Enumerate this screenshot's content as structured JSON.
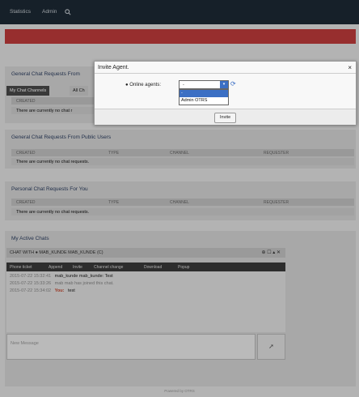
{
  "nav": {
    "items": [
      "Statistics",
      "Admin"
    ],
    "search_icon": "search-icon"
  },
  "sections": {
    "general_from": "General Chat Requests From",
    "general_public": "General Chat Requests From Public Users",
    "personal": "Personal Chat Requests For You",
    "active": "My Active Chats"
  },
  "tabs": {
    "my_channels": "My Chat Channels",
    "all": "All Ch"
  },
  "table": {
    "created": "CREATED",
    "type": "TYPE",
    "channel": "CHANNEL",
    "requester": "REQUESTER",
    "empty_partial": "There are currently no chat r",
    "empty": "There are currently no chat requests."
  },
  "modal": {
    "title": "Invite Agent.",
    "close": "×",
    "label": "Online agents:",
    "bullet": "●",
    "selected": "-",
    "options": [
      "-",
      "Admin OTRS"
    ],
    "invite": "Invite"
  },
  "chat": {
    "header": "CHAT WITH ● MAB_KUNDE MAB_KUNDE (C)",
    "header_controls": "⊕ ☐ ▴ ✕",
    "tools": [
      "Phone ticket",
      "Append",
      "Invite",
      "Channel change",
      "Download",
      "Popup"
    ],
    "messages": [
      {
        "ts": "2015-07-22 15:32:41",
        "name": "mab_kunde mab_kunde:",
        "text": "Test"
      },
      {
        "ts": "2015-07-22 15:33:26",
        "name": "",
        "text": "mab mab has joined this chat."
      },
      {
        "ts": "2015-07-22 15:34:02",
        "name": "You:",
        "text": "test"
      }
    ],
    "placeholder": "New Message",
    "send_icon": "send-icon"
  },
  "footer": "Powered by OTRS"
}
